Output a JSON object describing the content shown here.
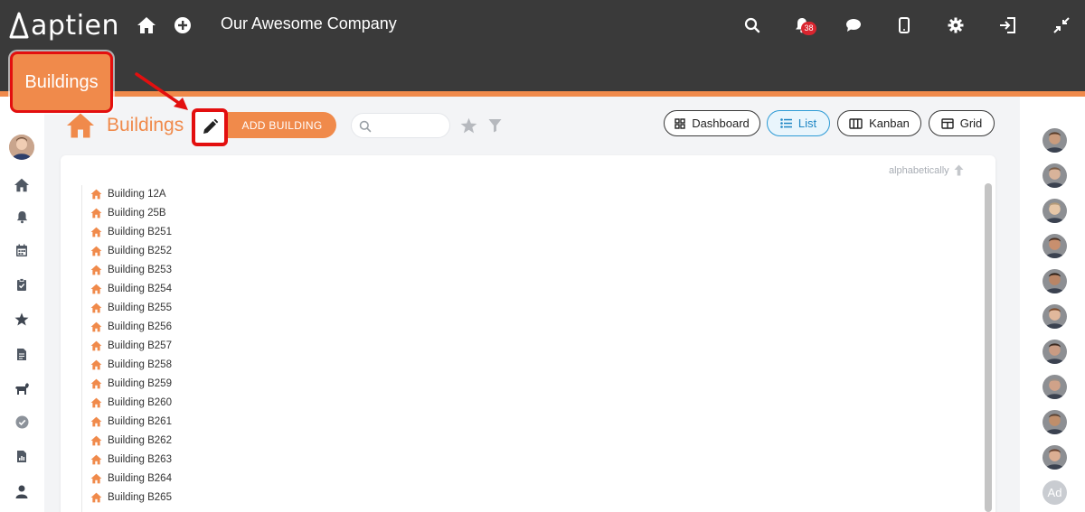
{
  "header": {
    "logo_text": "aptien",
    "company_name": "Our Awesome Company",
    "notification_count": "38"
  },
  "callout": {
    "label": "Buildings"
  },
  "page": {
    "title": "Buildings",
    "add_button_label": "ADD BUILDING",
    "search_placeholder": "",
    "sort_label": "alphabetically"
  },
  "views": [
    {
      "label": "Dashboard",
      "icon": "dashboard-icon",
      "active": false
    },
    {
      "label": "List",
      "icon": "list-icon",
      "active": true
    },
    {
      "label": "Kanban",
      "icon": "kanban-icon",
      "active": false
    },
    {
      "label": "Grid",
      "icon": "grid-icon",
      "active": false
    }
  ],
  "buildings": [
    "Building 12A",
    "Building 25B",
    "Building B251",
    "Building B252",
    "Building B253",
    "Building B254",
    "Building B255",
    "Building B256",
    "Building B257",
    "Building B258",
    "Building B259",
    "Building B260",
    "Building B261",
    "Building B262",
    "Building B263",
    "Building B264",
    "Building B265"
  ],
  "right_sidebar": {
    "add_label": "Ad"
  },
  "colors": {
    "accent": "#f08a4b",
    "topbar": "#3a3a3a",
    "highlight": "#e30f0f",
    "active_view": "#2d9bd6"
  }
}
